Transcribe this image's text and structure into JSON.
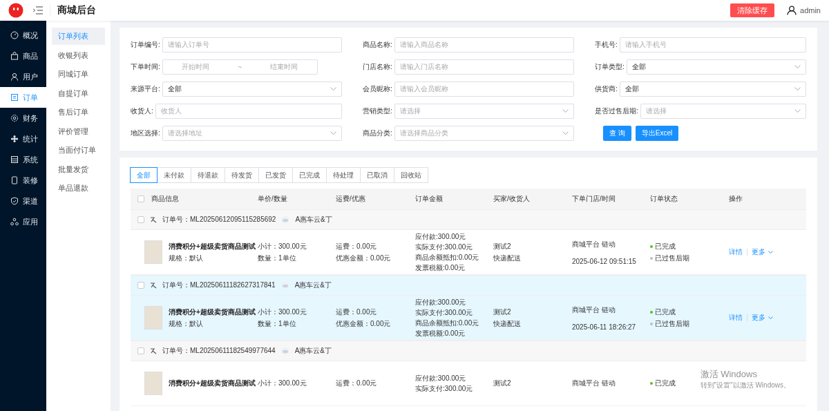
{
  "header": {
    "title": "商城后台",
    "clear_cache_button": "清除缓存",
    "user": "admin"
  },
  "nav": [
    {
      "label": "概况",
      "selected": false
    },
    {
      "label": "商品",
      "selected": false
    },
    {
      "label": "用户",
      "selected": false
    },
    {
      "label": "订单",
      "selected": true
    },
    {
      "label": "财务",
      "selected": false
    },
    {
      "label": "统计",
      "selected": false
    },
    {
      "label": "系统",
      "selected": false
    },
    {
      "label": "装修",
      "selected": false
    },
    {
      "label": "渠道",
      "selected": false
    },
    {
      "label": "应用",
      "selected": false
    }
  ],
  "subnav": [
    {
      "label": "订单列表",
      "selected": true
    },
    {
      "label": "收银列表",
      "selected": false
    },
    {
      "label": "同城订单",
      "selected": false
    },
    {
      "label": "自提订单",
      "selected": false
    },
    {
      "label": "售后订单",
      "selected": false
    },
    {
      "label": "评价管理",
      "selected": false
    },
    {
      "label": "当面付订单",
      "selected": false
    },
    {
      "label": "批量发货",
      "selected": false
    },
    {
      "label": "单品退款",
      "selected": false
    }
  ],
  "filters": [
    {
      "label": "订单编号:",
      "kind": "text",
      "placeholder": "请输入订单号"
    },
    {
      "label": "商品名称:",
      "kind": "text",
      "placeholder": "请输入商品名称"
    },
    {
      "label": "手机号:",
      "kind": "text",
      "placeholder": "请输入手机号"
    },
    {
      "label": "下单时间:",
      "kind": "daterange",
      "start_placeholder": "开始时间",
      "separator": "~",
      "end_placeholder": "结束时间"
    },
    {
      "label": "门店名称:",
      "kind": "text",
      "placeholder": "请输入门店名称"
    },
    {
      "label": "订单类型:",
      "kind": "select",
      "value": "全部"
    },
    {
      "label": "来源平台:",
      "kind": "select",
      "value": "全部"
    },
    {
      "label": "会员昵称:",
      "kind": "text",
      "placeholder": "请输入会员昵称"
    },
    {
      "label": "供货商:",
      "kind": "select",
      "value": "全部"
    },
    {
      "label": "收货人:",
      "kind": "text",
      "placeholder": "收货人"
    },
    {
      "label": "营销类型:",
      "kind": "select",
      "placeholder": "请选择"
    },
    {
      "label": "是否过售后期:",
      "kind": "select",
      "placeholder": "请选择"
    },
    {
      "label": "地区选择:",
      "kind": "select",
      "placeholder": "请选择地址"
    },
    {
      "label": "商品分类:",
      "kind": "select",
      "placeholder": "请选择商品分类"
    }
  ],
  "filter_buttons": [
    "查 询",
    "导出Excel"
  ],
  "tabs": [
    {
      "label": "全部",
      "selected": true
    },
    {
      "label": "未付款",
      "selected": false
    },
    {
      "label": "待退款",
      "selected": false
    },
    {
      "label": "待发货",
      "selected": false
    },
    {
      "label": "已发货",
      "selected": false
    },
    {
      "label": "已完成",
      "selected": false
    },
    {
      "label": "待处理",
      "selected": false
    },
    {
      "label": "已取消",
      "selected": false
    },
    {
      "label": "回收站",
      "selected": false
    }
  ],
  "table": {
    "select_all_checked": false,
    "columns": [
      "商品信息",
      "单价/数量",
      "运费/优惠",
      "订单金额",
      "买家/收货人",
      "下单门店/时间",
      "订单状态",
      "操作"
    ],
    "orders": [
      {
        "checked": false,
        "highlighted": false,
        "order_no": "订单号：ML20250612095115285692",
        "shop": "A惠车云&丁",
        "product": "消费积分+超级卖货商品测试",
        "spec": "规格：默认",
        "subtotal": "小计：300.00元",
        "quantity": "数量：1单位",
        "shipping": "运费：0.00元",
        "discount": "优惠金额：0.00元",
        "amounts": [
          "应付款:300.00元",
          "实际支付:300.00元",
          "商品余额抵扣:0.00元",
          "发票税额:0.00元"
        ],
        "buyer": "测试2",
        "delivery": "快递配送",
        "store": "商城平台 链动",
        "time": "2025-06-12 09:51:15",
        "statuses": [
          {
            "label": "已完成",
            "color": "#52c41a"
          },
          {
            "label": "已过售后期",
            "color": "#bfbfbf"
          }
        ],
        "actions": [
          "详情",
          "更多"
        ]
      },
      {
        "checked": false,
        "highlighted": true,
        "order_no": "订单号：ML20250611182627317841",
        "shop": "A惠车云&丁",
        "product": "消费积分+超级卖货商品测试",
        "spec": "规格：默认",
        "subtotal": "小计：300.00元",
        "quantity": "数量：1单位",
        "shipping": "运费：0.00元",
        "discount": "优惠金额：0.00元",
        "amounts": [
          "应付款:300.00元",
          "实际支付:300.00元",
          "商品余额抵扣:0.00元",
          "发票税额:0.00元"
        ],
        "buyer": "测试2",
        "delivery": "快递配送",
        "store": "商城平台 链动",
        "time": "2025-06-11 18:26:27",
        "statuses": [
          {
            "label": "已完成",
            "color": "#52c41a"
          },
          {
            "label": "已过售后期",
            "color": "#bfbfbf"
          }
        ],
        "actions": [
          "详情",
          "更多"
        ]
      },
      {
        "checked": false,
        "highlighted": false,
        "order_no": "订单号：ML20250611182549977644",
        "shop": "A惠车云&丁",
        "product": "消费积分+超级卖货商品测试",
        "subtotal": "小计：300.00元",
        "shipping": "运费：0.00元",
        "amounts": [
          "应付款:300.00元",
          "实际支付:300.00元"
        ],
        "buyer": "测试2",
        "store": "商城平台 链动",
        "statuses": [
          {
            "label": "已完成",
            "color": "#52c41a"
          }
        ]
      }
    ]
  },
  "os_notice": {
    "title": "激活 Windows",
    "text": "转到\"设置\"以激活 Windows。"
  }
}
